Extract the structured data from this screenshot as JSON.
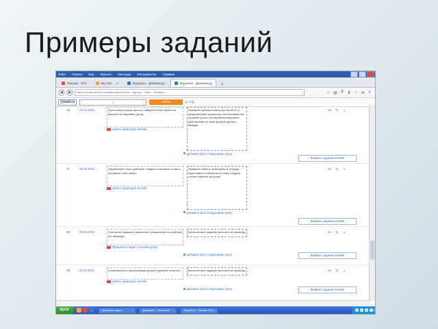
{
  "slide": {
    "title": "Примеры заданий"
  },
  "browser": {
    "menu": [
      "Файл",
      "Правка",
      "Вид",
      "Журнал",
      "Закладки",
      "Инструменты",
      "Справка"
    ],
    "tabs": [
      {
        "label": "Письма · IO%",
        "color": "#e84a3a"
      },
      {
        "label": "Вы Окн …  ×",
        "color": "#f5a623"
      },
      {
        "label": "Журналы · Дневник.ру",
        "color": "#2e7bd6"
      },
      {
        "label": "Журналы · Дневник.ру",
        "color": "#2e7bd6"
      }
    ],
    "newtab": "+",
    "url": "https://schools.dnevnik.ru/marks.aspx?school=...&group=...&tab=...&subject=...",
    "mail": {
      "logo": "@mail.ru",
      "input_value": "•",
      "find_button": "Найти"
    }
  },
  "rows": [
    {
      "num": "16",
      "date": "23.01.2021",
      "task": "Прочитайте строки текста и найдите в нём ответы на вопросы из задания к уроку.",
      "video": "Залить видеоурок онлайн",
      "answer": "Запишите краткие ответы (не более 5–6 предложений) на вопросы, использованные в начале урока. Постарайтесь выразить своё мнение по теме урока и сделать выводы.",
      "add": "Добавить ДЗ к следующему уроку",
      "choose": "Выбрать задание онлайн"
    },
    {
      "num": "17",
      "date": "06.02.2021",
      "task": "Перечитайте текст учебника, найдите ключевые слова и составьте план ответа.",
      "video": "Залить видеоурок онлайн",
      "answer": "Запишите ответы на вопросы в тетрадь, подготовьте сообщение по теме и будьте готовы ответить на уроке.",
      "add": "Добавить ДЗ к следующему уроку",
      "choose": "Выбрать задание онлайн"
    },
    {
      "num": "18",
      "date": "06.02.2021",
      "task": "Повторите правило и выполните упражнение из учебника (по образцу).",
      "video": "Прикрепить видео к онлайн-уроку",
      "answer": "Выполненное задание прислать на проверку",
      "add": "Добавить ДЗ к следующему уроку",
      "choose": "Выбрать задание онлайн"
    },
    {
      "num": "19",
      "date": "11.02.2021",
      "task": "Ознакомьтесь с материалами урока и сделайте конспект.",
      "video": "Залить видеоурок онлайн",
      "answer": "Выполненное задание прислать на проверку",
      "add": "Добавить ДЗ к следующему уроку",
      "choose": "Выбрать задание онлайн"
    }
  ],
  "taskbar": {
    "start": "пуск",
    "tasks": [
      "Примеры задан…",
      "Документ – Microsoft…",
      "Журналы – Mozilla Firef…"
    ],
    "clock": "12:44"
  }
}
